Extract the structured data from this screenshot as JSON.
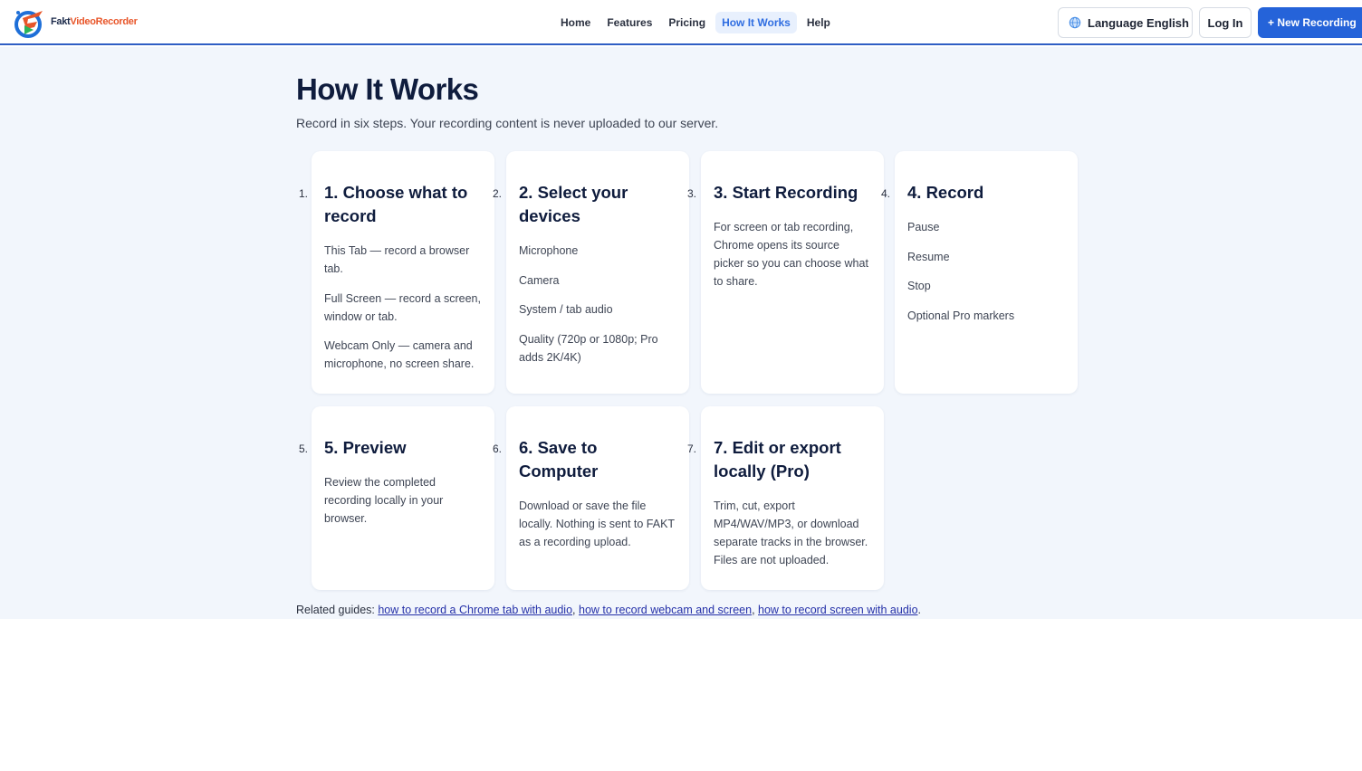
{
  "header": {
    "logo": {
      "text_part1": "Fakt",
      "text_part2": "VideoRecorder"
    },
    "nav": [
      {
        "label": "Home",
        "active": false
      },
      {
        "label": "Features",
        "active": false
      },
      {
        "label": "Pricing",
        "active": false
      },
      {
        "label": "How It Works",
        "active": true
      },
      {
        "label": "Help",
        "active": false
      }
    ],
    "language_label": "Language",
    "language_value": "English",
    "login_label": "Log In",
    "new_recording_label": "+ New Recording"
  },
  "page": {
    "title": "How It Works",
    "subtitle": "Record in six steps. Your recording content is never uploaded to our server."
  },
  "steps": [
    {
      "number": "1.",
      "title": "1. Choose what to record",
      "items": [
        "This Tab — record a browser tab.",
        "Full Screen — record a screen, window or tab.",
        "Webcam Only — camera and microphone, no screen share."
      ]
    },
    {
      "number": "2.",
      "title": "2. Select your devices",
      "items": [
        "Microphone",
        "Camera",
        "System / tab audio",
        "Quality (720p or 1080p; Pro adds 2K/4K)"
      ]
    },
    {
      "number": "3.",
      "title": "3. Start Recording",
      "text": "For screen or tab recording, Chrome opens its source picker so you can choose what to share."
    },
    {
      "number": "4.",
      "title": "4. Record",
      "items": [
        "Pause",
        "Resume",
        "Stop",
        "Optional Pro markers"
      ]
    },
    {
      "number": "5.",
      "title": "5. Preview",
      "text": "Review the completed recording locally in your browser."
    },
    {
      "number": "6.",
      "title": "6. Save to Computer",
      "text": "Download or save the file locally. Nothing is sent to FAKT as a recording upload."
    },
    {
      "number": "7.",
      "title": "7. Edit or export locally (Pro)",
      "text": "Trim, cut, export MP4/WAV/MP3, or download separate tracks in the browser. Files are not uploaded."
    }
  ],
  "related": {
    "prefix": "Related guides: ",
    "links": [
      "how to record a Chrome tab with audio",
      "how to record webcam and screen",
      "how to record screen with audio"
    ],
    "sep1": ", ",
    "sep2": ", ",
    "suffix": "."
  },
  "colors": {
    "accent": "#2563d9",
    "page_background": "#f2f6fc",
    "heading": "#0f1c3d"
  }
}
